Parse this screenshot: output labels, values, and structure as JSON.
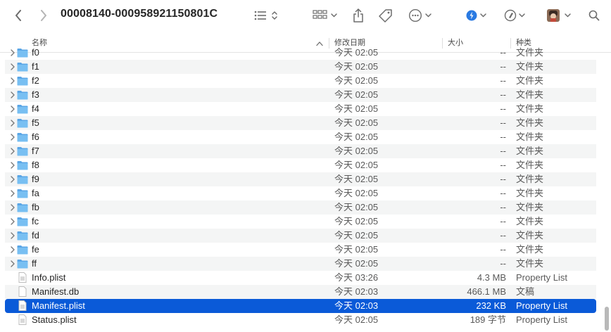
{
  "toolbar": {
    "title": "00008140-000958921150801C",
    "back_icon": "chevron-left-icon",
    "forward_icon": "chevron-right-icon",
    "list_view_icon": "list-view-icon",
    "group_icon": "grid-group-icon",
    "share_icon": "share-icon",
    "tag_icon": "tag-icon",
    "more_icon": "ellipsis-circle-icon",
    "accent_color": "#2a7ae2"
  },
  "columns": {
    "name": "名称",
    "date": "修改日期",
    "size": "大小",
    "kind": "种类"
  },
  "rows": [
    {
      "name": "f0",
      "date": "今天 02:05",
      "size": "--",
      "kind": "文件夹",
      "type": "folder"
    },
    {
      "name": "f1",
      "date": "今天 02:05",
      "size": "--",
      "kind": "文件夹",
      "type": "folder"
    },
    {
      "name": "f2",
      "date": "今天 02:05",
      "size": "--",
      "kind": "文件夹",
      "type": "folder"
    },
    {
      "name": "f3",
      "date": "今天 02:05",
      "size": "--",
      "kind": "文件夹",
      "type": "folder"
    },
    {
      "name": "f4",
      "date": "今天 02:05",
      "size": "--",
      "kind": "文件夹",
      "type": "folder"
    },
    {
      "name": "f5",
      "date": "今天 02:05",
      "size": "--",
      "kind": "文件夹",
      "type": "folder"
    },
    {
      "name": "f6",
      "date": "今天 02:05",
      "size": "--",
      "kind": "文件夹",
      "type": "folder"
    },
    {
      "name": "f7",
      "date": "今天 02:05",
      "size": "--",
      "kind": "文件夹",
      "type": "folder"
    },
    {
      "name": "f8",
      "date": "今天 02:05",
      "size": "--",
      "kind": "文件夹",
      "type": "folder"
    },
    {
      "name": "f9",
      "date": "今天 02:05",
      "size": "--",
      "kind": "文件夹",
      "type": "folder"
    },
    {
      "name": "fa",
      "date": "今天 02:05",
      "size": "--",
      "kind": "文件夹",
      "type": "folder"
    },
    {
      "name": "fb",
      "date": "今天 02:05",
      "size": "--",
      "kind": "文件夹",
      "type": "folder"
    },
    {
      "name": "fc",
      "date": "今天 02:05",
      "size": "--",
      "kind": "文件夹",
      "type": "folder"
    },
    {
      "name": "fd",
      "date": "今天 02:05",
      "size": "--",
      "kind": "文件夹",
      "type": "folder"
    },
    {
      "name": "fe",
      "date": "今天 02:05",
      "size": "--",
      "kind": "文件夹",
      "type": "folder"
    },
    {
      "name": "ff",
      "date": "今天 02:05",
      "size": "--",
      "kind": "文件夹",
      "type": "folder"
    },
    {
      "name": "Info.plist",
      "date": "今天 03:26",
      "size": "4.3 MB",
      "kind": "Property List",
      "type": "file"
    },
    {
      "name": "Manifest.db",
      "date": "今天 02:03",
      "size": "466.1 MB",
      "kind": "文稿",
      "type": "file"
    },
    {
      "name": "Manifest.plist",
      "date": "今天 02:03",
      "size": "232 KB",
      "kind": "Property List",
      "type": "file",
      "selected": true
    },
    {
      "name": "Status.plist",
      "date": "今天 02:05",
      "size": "189 字节",
      "kind": "Property List",
      "type": "file"
    }
  ]
}
